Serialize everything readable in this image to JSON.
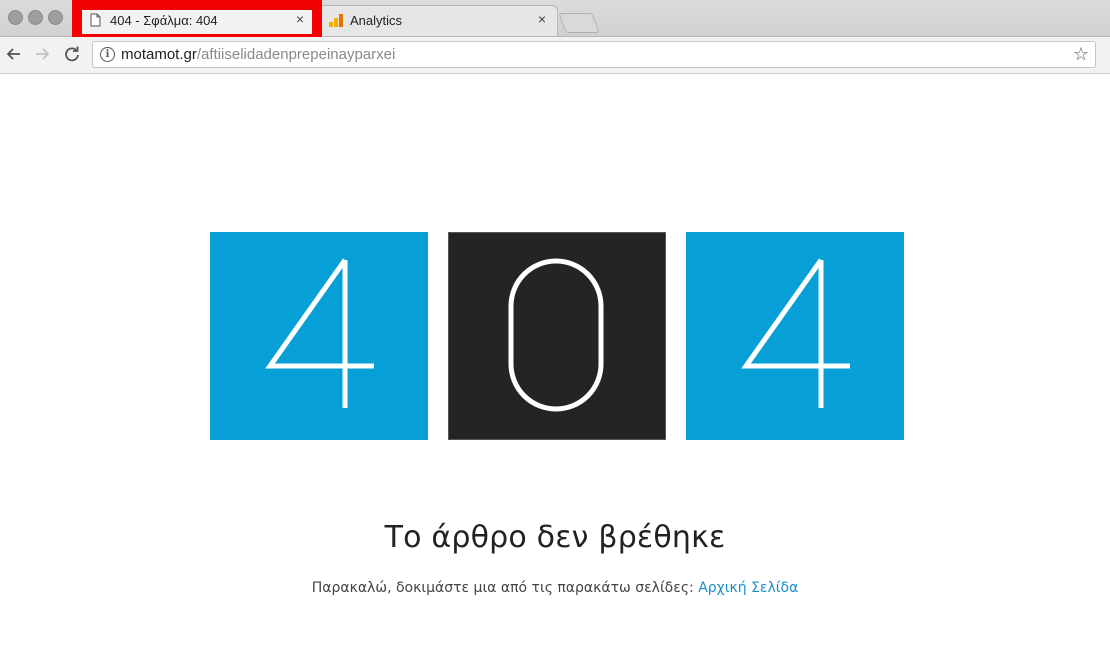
{
  "browser": {
    "tabs": [
      {
        "title": "404 - Σφάλμα: 404",
        "icon": "document-icon",
        "active": true
      },
      {
        "title": "Analytics",
        "icon": "analytics-icon",
        "active": false
      }
    ],
    "close_glyph": "×",
    "url_host": "motamot.gr",
    "url_path": "/aftiiselidadenprepeinayparxei"
  },
  "error": {
    "digits": [
      "4",
      "0",
      "4"
    ],
    "colors": {
      "blue": "#069fd6",
      "dark": "#242424"
    }
  },
  "message": {
    "heading": "Το άρθρο δεν βρέθηκε",
    "text": "Παρακαλώ, δοκιμάστε μια από τις παρακάτω σελίδες:",
    "link": "Αρχική Σελίδα",
    "link_color": "#1a8fc7"
  },
  "annotation": {
    "highlight_color": "#f30000"
  }
}
